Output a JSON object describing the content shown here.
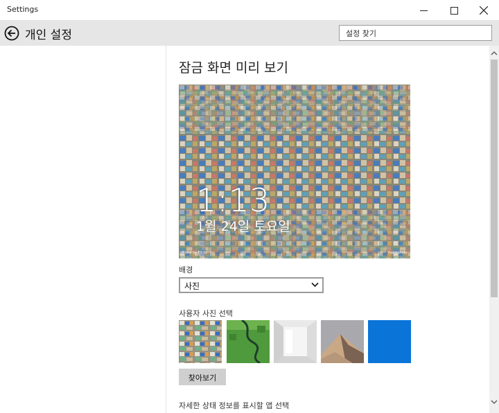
{
  "window": {
    "title": "Settings"
  },
  "header": {
    "title": "개인 설정",
    "search_placeholder": "설정 찾기"
  },
  "main": {
    "section_title": "잠금 화면 미리 보기",
    "preview": {
      "time": "1:13",
      "date": "1월 24일 토요일",
      "credit_left": "Photo by Flickr",
      "credit_right": "Yoonsphoto"
    },
    "background_label": "배경",
    "background_value": "사진",
    "user_photo_label": "사용자 사진 선택",
    "browse_label": "찾아보기",
    "detail_status_label": "자세한 상태 정보를 표시할 앱 선택"
  },
  "icons": {
    "back": "back-arrow-icon",
    "minimize": "minimize-icon",
    "maximize": "maximize-icon",
    "close": "close-icon",
    "dropdown": "chevron-down-icon",
    "scroll_up": "scroll-up-icon",
    "scroll_down": "scroll-down-icon"
  },
  "colors": {
    "accent_tile": "#0a74d9",
    "header_bg": "#e6e6e6",
    "browse_button": "#cfcfcf"
  }
}
